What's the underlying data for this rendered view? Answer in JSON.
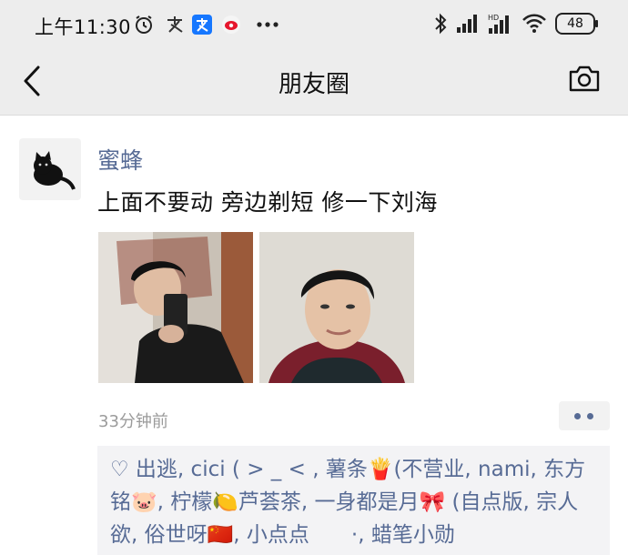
{
  "status_bar": {
    "time": "上午11:30",
    "battery": "48",
    "icons": [
      "alarm-icon",
      "alipay-icon",
      "alipay-icon",
      "weibo-icon",
      "more-dots-icon",
      "bluetooth-icon",
      "signal-icon",
      "signal-hd-icon",
      "wifi-icon",
      "battery-icon"
    ]
  },
  "nav": {
    "title": "朋友圈",
    "back_icon": "back-icon",
    "camera_icon": "camera-icon"
  },
  "post": {
    "author": "蜜蜂",
    "text": "上面不要动 旁边剃短 修一下刘海",
    "time": "33分钟前",
    "photos": [
      "photo-selfie-mirror",
      "photo-selfie-closeup"
    ],
    "likes_text": "♡ 出逃, cici ( > _ < , 薯条🍟(不营业, nami, 东方铭🐷, 柠檬🍋芦荟茶, 一身都是月🎀 (自点版, 宗人欲, 俗世呀🇨🇳, 小点点　　·, 蜡笔小勋"
  },
  "colors": {
    "link": "#576b95",
    "background_bar": "#ededed",
    "likes_bg": "#f3f3f5"
  }
}
